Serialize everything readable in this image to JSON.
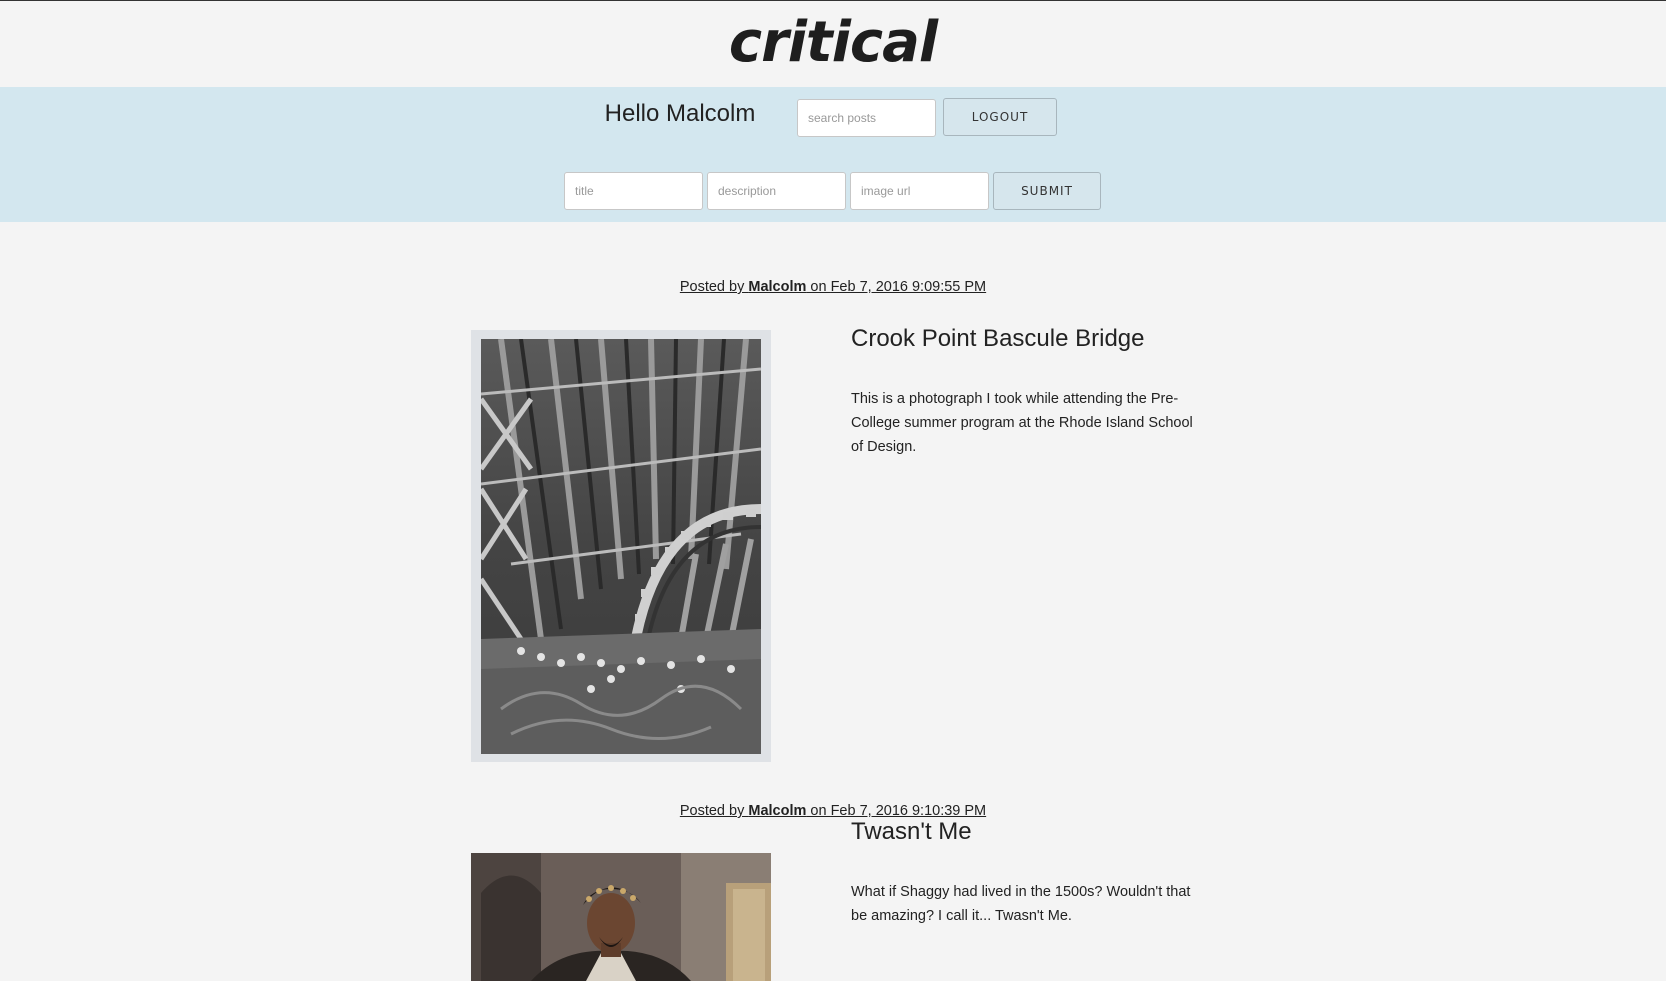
{
  "logo": {
    "text": "critical"
  },
  "header": {
    "greeting": "Hello Malcolm",
    "search_placeholder": "search posts",
    "logout_label": "LOGOUT"
  },
  "new_post_form": {
    "title_placeholder": "title",
    "description_placeholder": "description",
    "image_url_placeholder": "image url",
    "submit_label": "SUBMIT"
  },
  "posts": [
    {
      "meta_prefix": "Posted by ",
      "author": "Malcolm",
      "meta_mid": " on ",
      "date": "Feb 7, 2016 9:09:55 PM",
      "title": "Crook Point Bascule Bridge",
      "description": "This is a photograph I took while attending the Pre-College summer program at the Rhode Island School of Design."
    },
    {
      "meta_prefix": "Posted by ",
      "author": "Malcolm",
      "meta_mid": " on ",
      "date": "Feb 7, 2016 9:10:39 PM",
      "title": "Twasn't Me",
      "description": "What if Shaggy had lived in the 1500s? Wouldn't that be amazing? I call it... Twasn't Me."
    }
  ],
  "colors": {
    "page_background": "#f4f4f4",
    "header_band": "#d3e7ef",
    "button_background": "#d6e6ed",
    "text": "#222222"
  }
}
